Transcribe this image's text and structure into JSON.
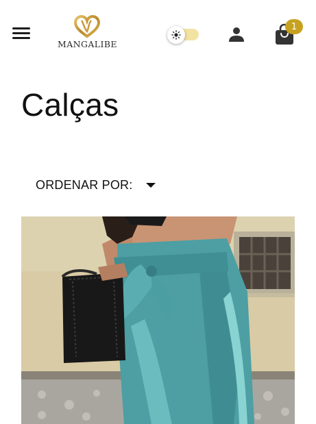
{
  "header": {
    "menu_icon": "hamburger-menu-icon",
    "logo_text": "MANGALIBE",
    "theme_toggle_icon": "sun-icon",
    "theme_toggle_on": false,
    "account_icon": "user-icon",
    "cart_icon": "shopping-bag-icon",
    "cart_count": "1",
    "accent_color": "#c6a21f"
  },
  "page": {
    "title": "Calças"
  },
  "sort": {
    "label": "ORDENAR POR:",
    "caret_icon": "caret-down-icon"
  },
  "products": [
    {
      "image_subject": "model wearing teal satin trousers with tie belt, holding black handbag"
    }
  ]
}
